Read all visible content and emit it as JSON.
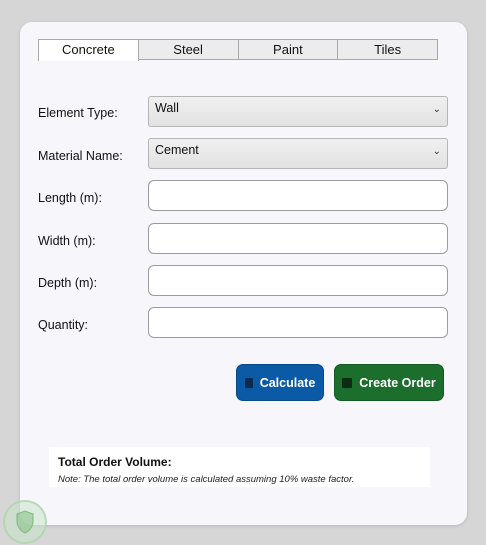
{
  "tabs": [
    "Concrete",
    "Steel",
    "Paint",
    "Tiles"
  ],
  "active_tab": 0,
  "form": {
    "element_type_label": "Element Type:",
    "element_type_value": "Wall",
    "material_name_label": "Material Name:",
    "material_name_value": "Cement",
    "length_label": "Length (m):",
    "width_label": "Width (m):",
    "depth_label": "Depth (m):",
    "quantity_label": "Quantity:",
    "dropdown_chevron": "⌄"
  },
  "buttons": {
    "calculate": "Calculate",
    "create_order": "Create Order"
  },
  "summary": {
    "title": "Total Order Volume:",
    "note": "Note: The total order volume is calculated assuming 10% waste factor."
  },
  "colors": {
    "calculate_button": "#0b5aa5",
    "create_order_button": "#1b6e2c",
    "card_background": "#f6f6fb"
  },
  "icons": {
    "calculate": "calculator-icon",
    "create_order": "order-icon"
  }
}
